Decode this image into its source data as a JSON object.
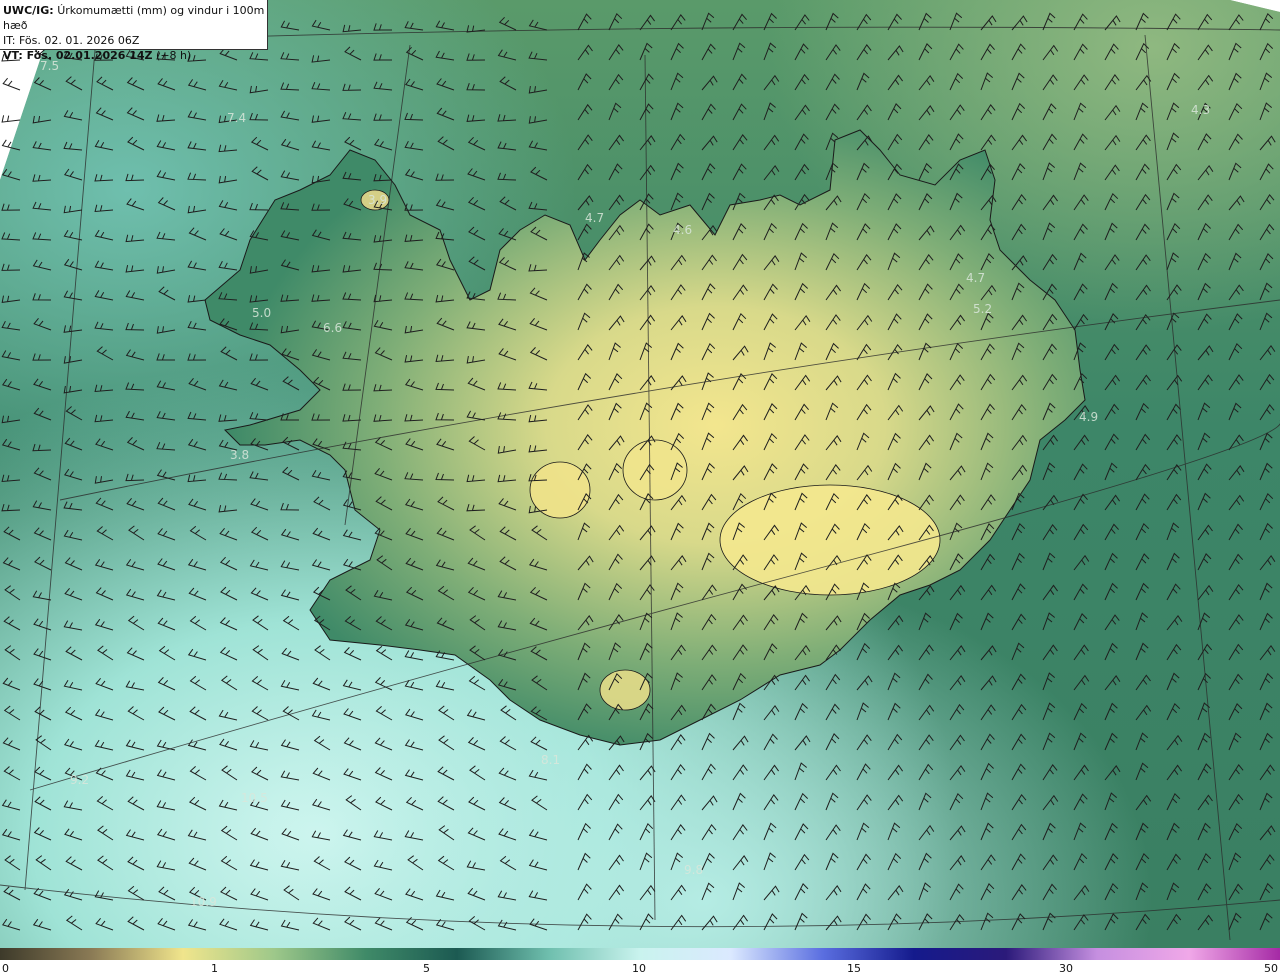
{
  "header": {
    "model": "UWC/IG:",
    "title": "Úrkomumætti (mm) og vindur i 100m hæð",
    "init_time": "IT: Fös. 02. 01. 2026 06Z",
    "valid_prefix": "VT: Fös. 02.01.2026 14Z",
    "valid_suffix": "(+8 h)"
  },
  "labels": [
    {
      "id": "l1",
      "text": "7.5"
    },
    {
      "id": "l2",
      "text": "7.4"
    },
    {
      "id": "l3",
      "text": "3.9"
    },
    {
      "id": "l4",
      "text": "4.7"
    },
    {
      "id": "l5",
      "text": "4.6"
    },
    {
      "id": "l6",
      "text": "5.0"
    },
    {
      "id": "l7",
      "text": "6.6"
    },
    {
      "id": "l8",
      "text": "3.8"
    },
    {
      "id": "l9",
      "text": "4.7"
    },
    {
      "id": "l10",
      "text": "5.2"
    },
    {
      "id": "l11",
      "text": "4.9"
    },
    {
      "id": "l12",
      "text": "4.3"
    },
    {
      "id": "l13",
      "text": "8.1"
    },
    {
      "id": "l14",
      "text": "9.2"
    },
    {
      "id": "l15",
      "text": "10.5"
    },
    {
      "id": "l16",
      "text": "9.8"
    },
    {
      "id": "l17",
      "text": "10.9"
    }
  ],
  "colorbar": {
    "ticks": [
      "0",
      "1",
      "5",
      "10",
      "15",
      "30",
      "50"
    ],
    "colors": [
      "#3d3a2a",
      "#8a7a55",
      "#f0e58c",
      "#9ec88a",
      "#3f8a68",
      "#1c5a52",
      "#6fbfae",
      "#c9f3ee",
      "#dbe9ff",
      "#5a6ee0",
      "#141a8c",
      "#2b1a7a",
      "#c58fe0",
      "#f0a8e8",
      "#a52aa5"
    ]
  },
  "colors": {
    "ocean_far": "#2e6b5a",
    "ocean_mid": "#3f8a68",
    "ocean_light": "#9fe3d6",
    "land_high": "#f1e48c",
    "land_mid": "#b9c97e",
    "coast_line": "#1a1a1a"
  }
}
